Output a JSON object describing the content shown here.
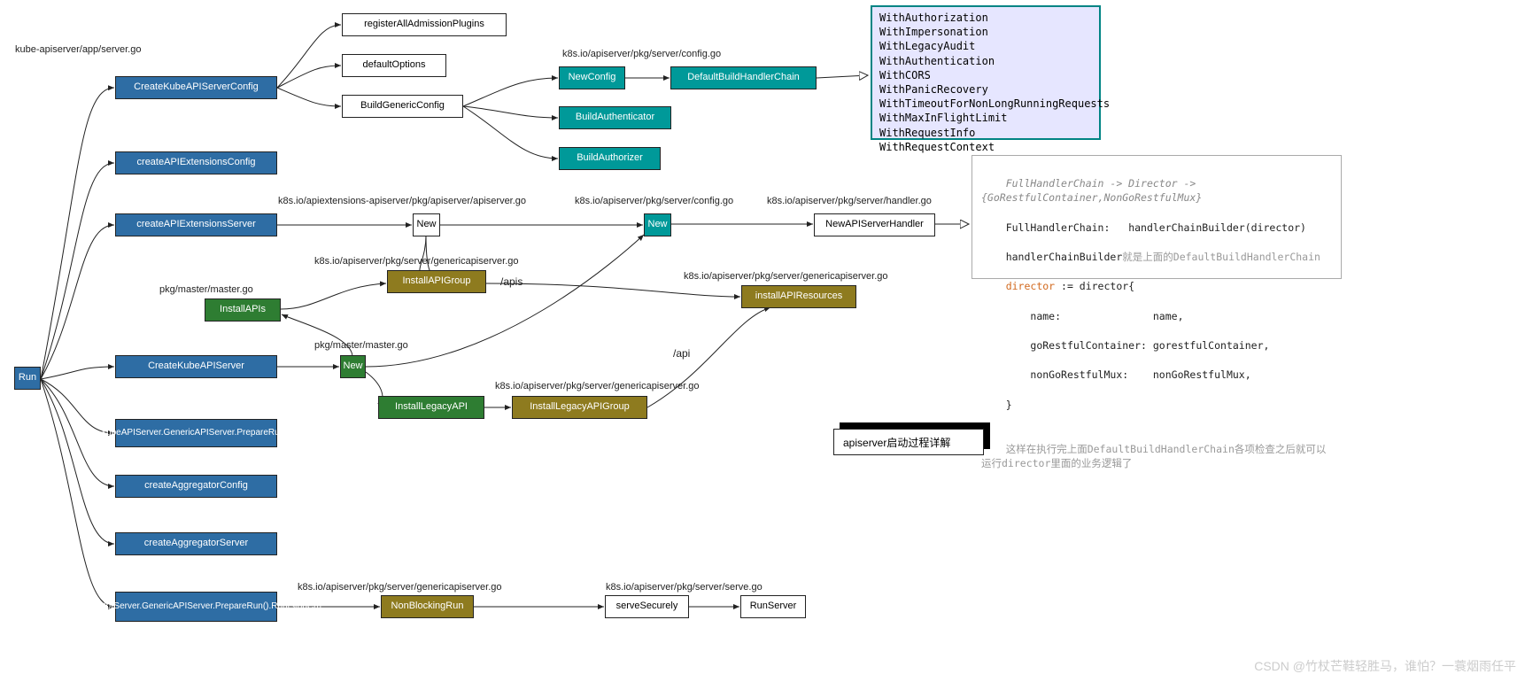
{
  "nodes": {
    "run": "Run",
    "ckasc": "CreateKubeAPIServerConfig",
    "caec": "createAPIExtensionsConfig",
    "caes": "createAPIExtensionsServer",
    "ckas": "CreateKubeAPIServer",
    "prep": "kubeAPIServer.GenericAPIServer.PrepareRun()",
    "cac": "createAggregatorConfig",
    "cas": "createAggregatorServer",
    "aggrun": "aggregatorServer.GenericAPIServer.PrepareRun().Run(stopCh)",
    "rap": "registerAllAdmissionPlugins",
    "dopt": "defaultOptions",
    "bgc": "BuildGenericConfig",
    "newcfg": "NewConfig",
    "dbhc": "DefaultBuildHandlerChain",
    "bauthn": "BuildAuthenticator",
    "bauthz": "BuildAuthorizer",
    "newext": "New",
    "newcfgsrv": "New",
    "newash": "NewAPIServerHandler",
    "iag": "InstallAPIGroup",
    "iar": "installAPIResources",
    "iapis": "InstallAPIs",
    "newm": "New",
    "ila": "InstallLegacyAPI",
    "ilag": "InstallLegacyAPIGroup",
    "nbr": "NonBlockingRun",
    "ssec": "serveSecurely",
    "runsrv": "RunServer"
  },
  "pathlabels": {
    "appserver": "kube-apiserver/app/server.go",
    "configgo1": "k8s.io/apiserver/pkg/server/config.go",
    "extsrv": "k8s.io/apiextensions-apiserver/pkg/apiserver/apiserver.go",
    "configgo2": "k8s.io/apiserver/pkg/server/config.go",
    "handlergo": "k8s.io/apiserver/pkg/server/handler.go",
    "generic1": "k8s.io/apiserver/pkg/server/genericapiserver.go",
    "generic2": "k8s.io/apiserver/pkg/server/genericapiserver.go",
    "generic3": "k8s.io/apiserver/pkg/server/genericapiserver.go",
    "master1": "pkg/master/master.go",
    "master2": "pkg/master/master.go",
    "generic4": "k8s.io/apiserver/pkg/server/genericapiserver.go",
    "servego": "k8s.io/apiserver/pkg/server/serve.go"
  },
  "edgelabels": {
    "apis": "/apis",
    "api": "/api"
  },
  "note1_lines": "WithAuthorization\nWithImpersonation\nWithLegacyAudit\nWithAuthentication\nWithCORS\nWithPanicRecovery\nWithTimeoutForNonLongRunningRequests\nWithMaxInFlightLimit\nWithRequestInfo\nWithRequestContext",
  "note2": {
    "l1": "FullHandlerChain -> Director -> {GoRestfulContainer,NonGoRestfulMux}",
    "l2a": "FullHandlerChain:",
    "l2b": "handlerChainBuilder(director)",
    "l3a": "handlerChainBuilder",
    "l3b": "就是上面的DefaultBuildHandlerChain",
    "l4a": "director",
    "l4b": " := director{",
    "l5": "    name:               name,",
    "l6": "    goRestfulContainer: gorestfulContainer,",
    "l7": "    nonGoRestfulMux:    nonGoRestfulMux,",
    "l8": "}",
    "l9": "这样在执行完上面DefaultBuildHandlerChain各项检查之后就可以运行director里面的业务逻辑了"
  },
  "titlebox": "apiserver启动过程详解",
  "watermark": "CSDN @竹杖芒鞋轻胜马，谁怕？一蓑烟雨任平"
}
